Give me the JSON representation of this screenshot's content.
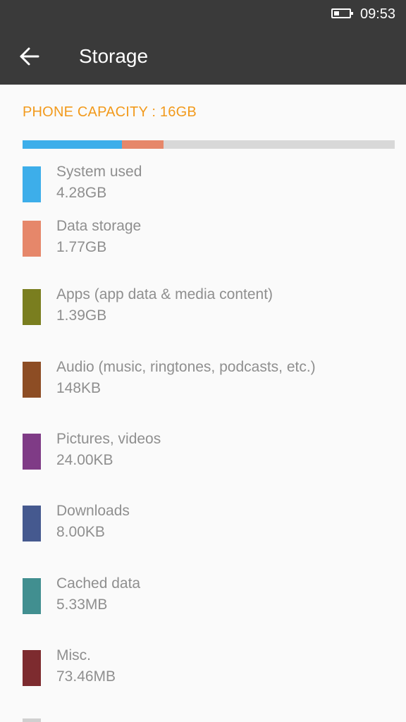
{
  "status_bar": {
    "time": "09:53",
    "battery_level": 0.35
  },
  "app_bar": {
    "title": "Storage",
    "back_icon": "arrow-left-icon"
  },
  "capacity": {
    "title": "PHONE CAPACITY : 16GB",
    "accent_color": "#f29a1c",
    "bar_background": "#d8d8d8",
    "segments": [
      {
        "color": "#3daeea",
        "fraction": 0.267
      },
      {
        "color": "#e6876a",
        "fraction": 0.111
      }
    ]
  },
  "categories": [
    {
      "name": "System used",
      "size": "4.28GB",
      "color": "#3daeea"
    },
    {
      "name": "Data storage",
      "size": "1.77GB",
      "color": "#e6876a"
    },
    {
      "name": "Apps (app data & media content)",
      "size": "1.39GB",
      "color": "#7a7e1f"
    },
    {
      "name": "Audio (music, ringtones, podcasts, etc.)",
      "size": "148KB",
      "color": "#8d4d24"
    },
    {
      "name": "Pictures, videos",
      "size": "24.00KB",
      "color": "#7f3b86"
    },
    {
      "name": "Downloads",
      "size": "8.00KB",
      "color": "#45598f"
    },
    {
      "name": "Cached data",
      "size": "5.33MB",
      "color": "#418f90"
    },
    {
      "name": "Misc.",
      "size": "73.46MB",
      "color": "#7d2b2f"
    }
  ]
}
